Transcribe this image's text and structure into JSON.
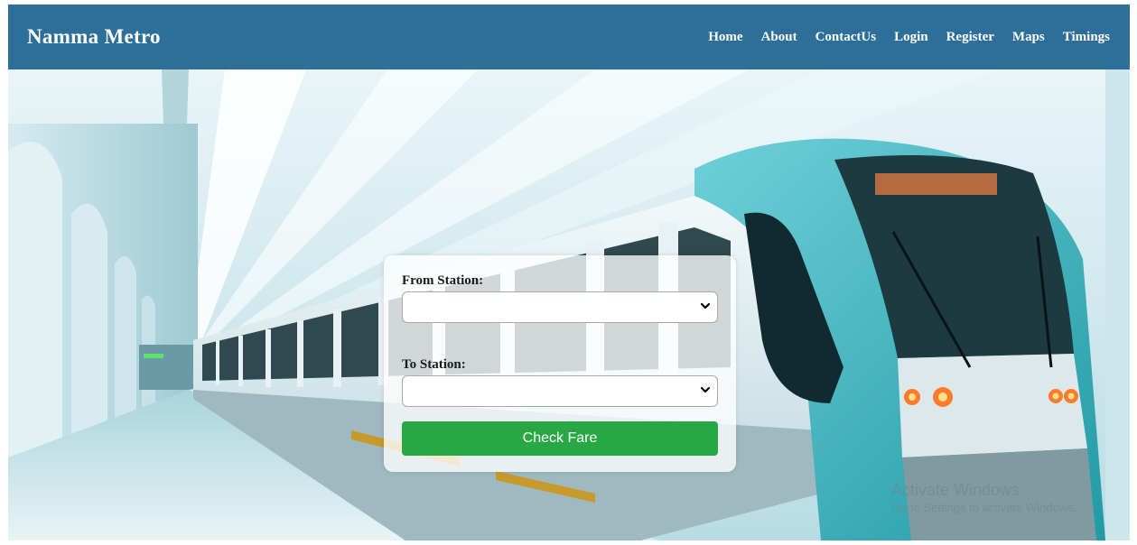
{
  "header": {
    "brand": "Namma Metro",
    "nav": [
      {
        "label": "Home"
      },
      {
        "label": "About"
      },
      {
        "label": "ContactUs"
      },
      {
        "label": "Login"
      },
      {
        "label": "Register"
      },
      {
        "label": "Maps"
      },
      {
        "label": "Timings"
      }
    ]
  },
  "form": {
    "from_label": "From Station:",
    "from_value": "",
    "to_label": "To Station:",
    "to_value": "",
    "submit_label": "Check Fare"
  },
  "watermark": {
    "title": "Activate Windows",
    "subtitle": "Go to Settings to activate Windows."
  },
  "colors": {
    "navbar": "#2d6f99",
    "button": "#28a745",
    "train_teal": "#3bb3bf"
  },
  "icons": {
    "select_arrow": "chevron-down-icon"
  }
}
